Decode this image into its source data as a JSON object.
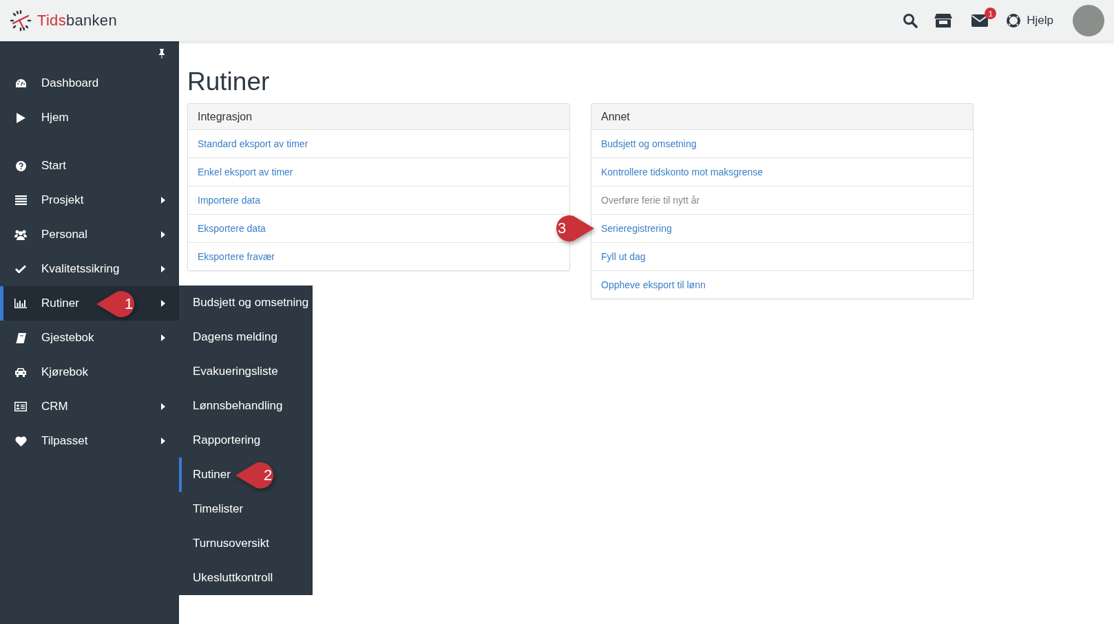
{
  "header": {
    "logo_prefix": "Tids",
    "logo_suffix": "banken",
    "mail_badge": "1",
    "help": "Hjelp"
  },
  "sidebar": {
    "groups": [
      [
        {
          "label": "Dashboard",
          "has_submenu": false,
          "selected": false
        },
        {
          "label": "Hjem",
          "has_submenu": false,
          "selected": false
        }
      ],
      [
        {
          "label": "Start",
          "has_submenu": false,
          "selected": false
        },
        {
          "label": "Prosjekt",
          "has_submenu": true,
          "selected": false
        },
        {
          "label": "Personal",
          "has_submenu": true,
          "selected": false
        },
        {
          "label": "Kvalitetssikring",
          "has_submenu": true,
          "selected": false
        },
        {
          "label": "Rutiner",
          "has_submenu": true,
          "selected": true
        },
        {
          "label": "Gjestebok",
          "has_submenu": true,
          "selected": false
        },
        {
          "label": "Kjørebok",
          "has_submenu": false,
          "selected": false
        },
        {
          "label": "CRM",
          "has_submenu": true,
          "selected": false
        },
        {
          "label": "Tilpasset",
          "has_submenu": true,
          "selected": false
        }
      ]
    ]
  },
  "submenu": [
    {
      "label": "Budsjett og omsetning",
      "selected": false
    },
    {
      "label": "Dagens melding",
      "selected": false
    },
    {
      "label": "Evakueringsliste",
      "selected": false
    },
    {
      "label": "Lønnsbehandling",
      "selected": false
    },
    {
      "label": "Rapportering",
      "selected": false
    },
    {
      "label": "Rutiner",
      "selected": true
    },
    {
      "label": "Timelister",
      "selected": false
    },
    {
      "label": "Turnusoversikt",
      "selected": false
    },
    {
      "label": "Ukesluttkontroll",
      "selected": false
    }
  ],
  "page_title": "Rutiner",
  "panels": [
    {
      "title": "Integrasjon",
      "links": [
        {
          "label": "Standard eksport av timer",
          "disabled": false
        },
        {
          "label": "Enkel eksport av timer",
          "disabled": false
        },
        {
          "label": "Importere data",
          "disabled": false
        },
        {
          "label": "Eksportere data",
          "disabled": false
        },
        {
          "label": "Eksportere fravær",
          "disabled": false
        }
      ]
    },
    {
      "title": "Annet",
      "links": [
        {
          "label": "Budsjett og omsetning",
          "disabled": false
        },
        {
          "label": "Kontrollere tidskonto mot maksgrense",
          "disabled": false
        },
        {
          "label": "Overføre ferie til nytt år",
          "disabled": true
        },
        {
          "label": "Serieregistrering",
          "disabled": false
        },
        {
          "label": "Fyll ut dag",
          "disabled": false
        },
        {
          "label": "Oppheve eksport til lønn",
          "disabled": false
        }
      ]
    }
  ],
  "callouts": [
    {
      "label": "1"
    },
    {
      "label": "2"
    },
    {
      "label": "3"
    }
  ]
}
